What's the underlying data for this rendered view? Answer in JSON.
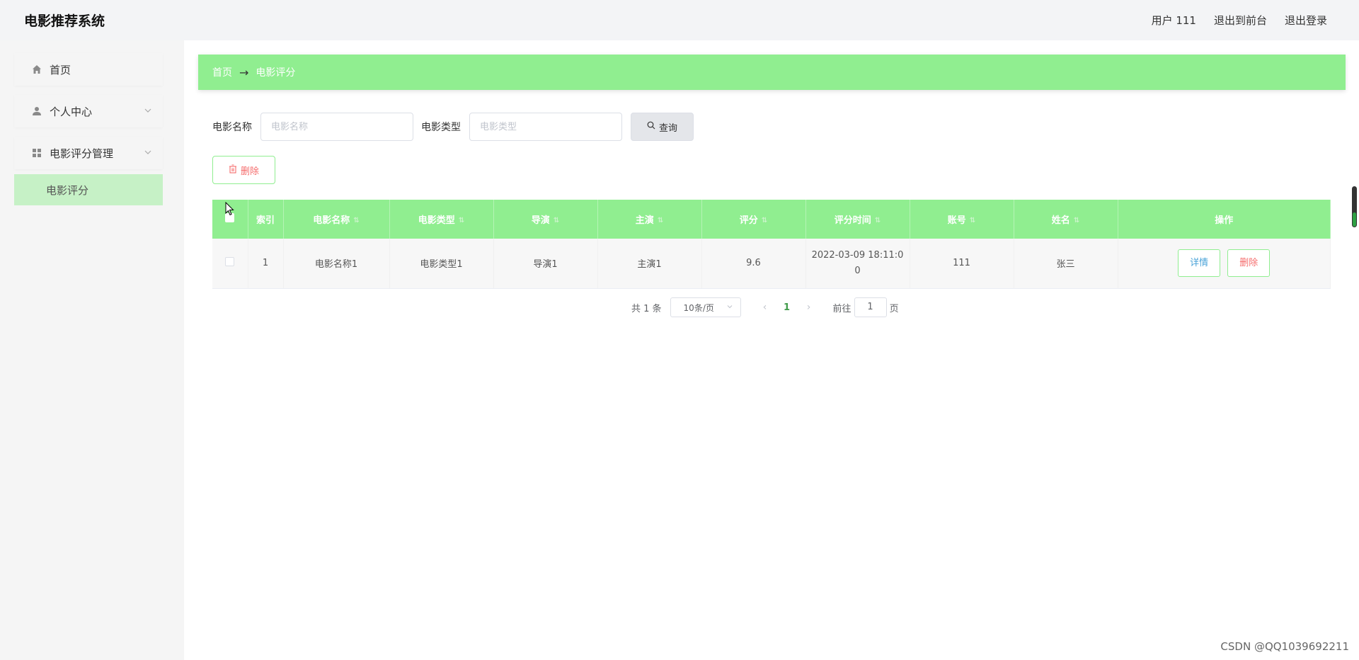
{
  "header": {
    "app_title": "电影推荐系统",
    "user_label": "用户 111",
    "to_front_label": "退出到前台",
    "logout_label": "退出登录"
  },
  "sidebar": {
    "items": [
      {
        "label": "首页",
        "icon": "home-icon"
      },
      {
        "label": "个人中心",
        "icon": "user-icon"
      },
      {
        "label": "电影评分管理",
        "icon": "grid-icon"
      }
    ],
    "submenu_active": "电影评分"
  },
  "breadcrumb": {
    "home": "首页",
    "separator": "→",
    "current": "电影评分"
  },
  "search": {
    "name_label": "电影名称",
    "name_placeholder": "电影名称",
    "type_label": "电影类型",
    "type_placeholder": "电影类型",
    "query_label": "查询"
  },
  "actions": {
    "delete_label": "删除"
  },
  "table": {
    "columns": [
      "索引",
      "电影名称",
      "电影类型",
      "导演",
      "主演",
      "评分",
      "评分时间",
      "账号",
      "姓名",
      "操作"
    ],
    "rows": [
      {
        "index": "1",
        "name": "电影名称1",
        "type": "电影类型1",
        "director": "导演1",
        "actor": "主演1",
        "score": "9.6",
        "time": "2022-03-09 18:11:00",
        "account": "111",
        "realname": "张三",
        "detail_label": "详情",
        "delete_label": "删除"
      }
    ]
  },
  "pagination": {
    "total": "共 1 条",
    "page_size": "10条/页",
    "current_page": "1",
    "goto_prefix": "前往",
    "goto_value": "1",
    "goto_suffix": "页"
  },
  "watermark": "CSDN @QQ1039692211",
  "colors": {
    "accent": "#90ee90",
    "submenu_bg": "#c6f1c6",
    "danger": "#f56c6c",
    "info": "#4aa3d8"
  }
}
